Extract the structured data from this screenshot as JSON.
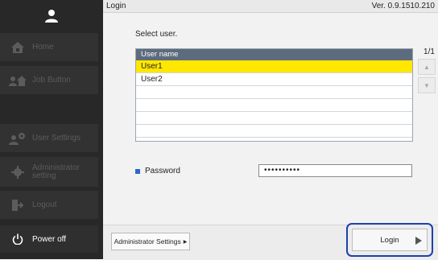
{
  "sidebar": {
    "items": [
      {
        "label": "Home",
        "icon": "home-icon"
      },
      {
        "label": "Job Button",
        "icon": "job-button-icon"
      },
      {
        "label": "User Settings",
        "icon": "user-settings-icon"
      },
      {
        "label": "Administrator\nsetting",
        "icon": "gear-icon"
      },
      {
        "label": "Logout",
        "icon": "logout-icon"
      }
    ],
    "power_label": "Power off"
  },
  "header": {
    "title": "Login",
    "version": "Ver. 0.9.1510.210"
  },
  "main": {
    "prompt": "Select user.",
    "list_header": "User name",
    "users": [
      "User1",
      "User2",
      "",
      "",
      "",
      ""
    ],
    "pager": "1/1",
    "password_label": "Password",
    "password_value": "••••••••••"
  },
  "footer": {
    "admin_label": "Administrator Settings",
    "login_label": "Login"
  },
  "colors": {
    "selected_row": "#ffe700",
    "header_row": "#5c6b7d",
    "accent_blue": "#2f66c9",
    "login_focus": "#1f3fae"
  }
}
